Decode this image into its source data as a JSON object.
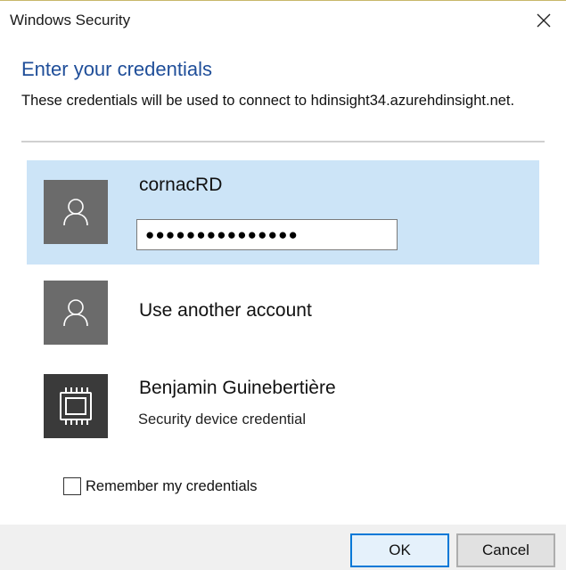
{
  "window": {
    "title": "Windows Security"
  },
  "header": {
    "heading": "Enter your credentials",
    "description": "These credentials will be used to connect to hdinsight34.azurehdinsight.net."
  },
  "accounts": [
    {
      "name": "cornacRD",
      "icon": "user-icon",
      "selected": true,
      "password_mask": "●●●●●●●●●●●●●●●"
    },
    {
      "name": "Use another account",
      "icon": "user-icon"
    },
    {
      "name": "Benjamin Guinebertière",
      "subtitle": "Security device credential",
      "icon": "chip-icon"
    }
  ],
  "remember": {
    "label": "Remember my credentials",
    "checked": false
  },
  "buttons": {
    "ok": "OK",
    "cancel": "Cancel"
  },
  "colors": {
    "heading": "#1f4e99",
    "selection": "#cce4f7",
    "avatar": "#6b6b6b",
    "focus_border": "#0078d7"
  }
}
